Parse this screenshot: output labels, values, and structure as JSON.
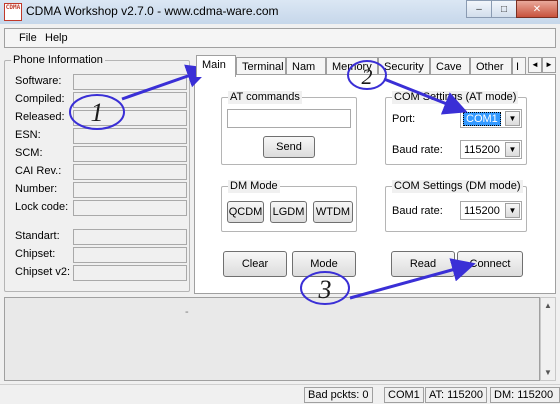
{
  "window": {
    "icon_text": "CDMA",
    "title": "CDMA Workshop v2.7.0  -  www.cdma-ware.com",
    "minimize": "–",
    "maximize": "□",
    "close": "✕"
  },
  "menu": {
    "items": [
      "File",
      "Help"
    ]
  },
  "phone_info": {
    "title": "Phone Information",
    "fields": [
      "Software:",
      "Compiled:",
      "Released:",
      "ESN:",
      "SCM:",
      "CAI Rev.:",
      "Number:",
      "Lock code:",
      "Standart:",
      "Chipset:",
      "Chipset v2:"
    ]
  },
  "tabs": {
    "items": [
      "Main",
      "Terminal",
      "Nam",
      "Memory",
      "Security",
      "Cave",
      "Other",
      "I"
    ],
    "active": "Main",
    "scroll_left": "◄",
    "scroll_right": "►"
  },
  "main_tab": {
    "at_commands": {
      "title": "AT commands",
      "input_value": "",
      "send_label": "Send"
    },
    "dm_mode": {
      "title": "DM Mode",
      "buttons": [
        "QCDM",
        "LGDM",
        "WTDM"
      ]
    },
    "com_at": {
      "title": "COM Settings (AT mode)",
      "port_label": "Port:",
      "port_value": "COM1",
      "baud_label": "Baud rate:",
      "baud_value": "115200"
    },
    "com_dm": {
      "title": "COM Settings (DM mode)",
      "baud_label": "Baud rate:",
      "baud_value": "115200"
    },
    "buttons": {
      "clear": "Clear",
      "mode": "Mode",
      "read": "Read",
      "connect": "Connect"
    }
  },
  "log": {
    "content": "-"
  },
  "status": {
    "bad_packets": "Bad pckts: 0",
    "com": "COM1",
    "at_rate": "AT: 115200",
    "dm_rate": "DM: 115200"
  },
  "annotations": {
    "one": "1",
    "two": "2",
    "three": "3",
    "color": "#3a2fd6"
  }
}
